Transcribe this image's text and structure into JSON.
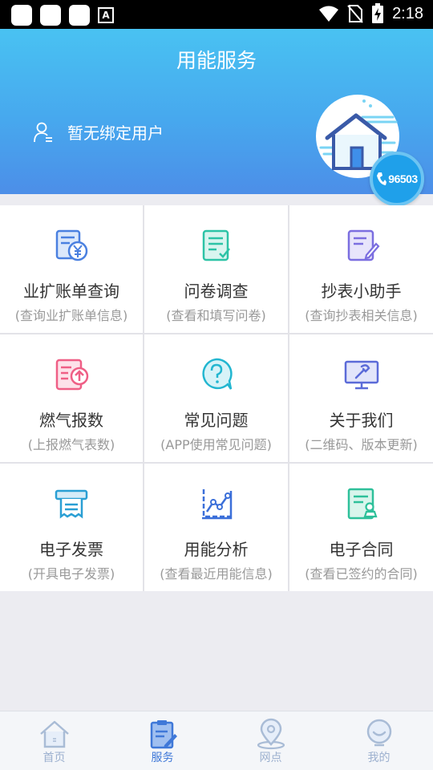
{
  "status_bar": {
    "time": "2:18",
    "a_glyph": "A"
  },
  "header": {
    "title": "用能服务",
    "user_text": "暂无绑定用户",
    "hotline": "96503"
  },
  "services": [
    {
      "title": "业扩账单查询",
      "subtitle": "(查询业扩账单信息)",
      "icon": "bill-yen-icon",
      "color": "#4a80e0"
    },
    {
      "title": "问卷调查",
      "subtitle": "(查看和填写问卷)",
      "icon": "survey-icon",
      "color": "#2cc3a6"
    },
    {
      "title": "抄表小助手",
      "subtitle": "(查询抄表相关信息)",
      "icon": "meter-edit-icon",
      "color": "#7b6ee0"
    },
    {
      "title": "燃气报数",
      "subtitle": "(上报燃气表数)",
      "icon": "gas-report-icon",
      "color": "#ef5f86"
    },
    {
      "title": "常见问题",
      "subtitle": "(APP使用常见问题)",
      "icon": "faq-icon",
      "color": "#22b6d0"
    },
    {
      "title": "关于我们",
      "subtitle": "(二维码、版本更新)",
      "icon": "about-monitor-icon",
      "color": "#5b6bd8"
    },
    {
      "title": "电子发票",
      "subtitle": "(开具电子发票)",
      "icon": "invoice-printer-icon",
      "color": "#2a9fd4"
    },
    {
      "title": "用能分析",
      "subtitle": "(查看最近用能信息)",
      "icon": "analysis-chart-icon",
      "color": "#3b6fd9"
    },
    {
      "title": "电子合同",
      "subtitle": "(查看已签约的合同)",
      "icon": "contract-icon",
      "color": "#2ec09a"
    }
  ],
  "bottom_nav": [
    {
      "label": "首页",
      "icon": "home-icon"
    },
    {
      "label": "服务",
      "icon": "service-icon",
      "active": true
    },
    {
      "label": "网点",
      "icon": "location-pin-icon"
    },
    {
      "label": "我的",
      "icon": "profile-smile-icon"
    }
  ]
}
